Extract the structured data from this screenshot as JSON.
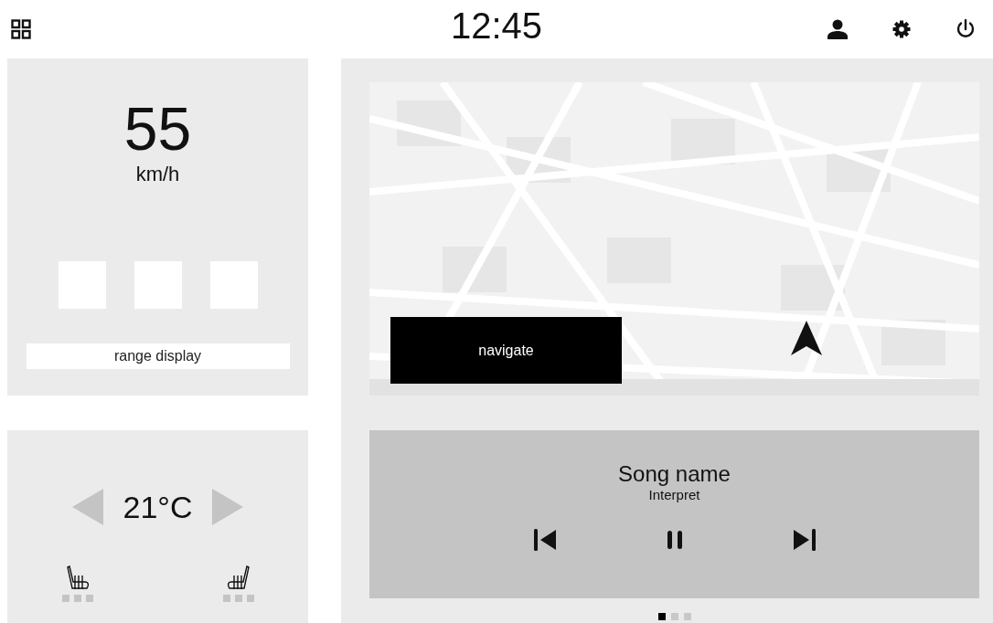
{
  "top_bar": {
    "clock": "12:45"
  },
  "speed": {
    "value": "55",
    "unit": "km/h",
    "indicators": [
      {
        "on": false
      },
      {
        "on": false
      },
      {
        "on": false
      }
    ],
    "range_label": "range display"
  },
  "climate": {
    "temperature": "21°C",
    "seats": [
      {
        "mirrored": false,
        "levels": [
          {
            "on": false
          },
          {
            "on": false
          },
          {
            "on": false
          }
        ]
      },
      {
        "mirrored": true,
        "levels": [
          {
            "on": false
          },
          {
            "on": false
          },
          {
            "on": false
          }
        ]
      }
    ]
  },
  "map": {
    "kind": "picture",
    "navigate_label": "navigate"
  },
  "media": {
    "song": "Song name",
    "artist": "Interpret",
    "playing": true
  },
  "pages": [
    {
      "selected": true
    },
    {
      "selected": false
    },
    {
      "selected": false
    }
  ]
}
